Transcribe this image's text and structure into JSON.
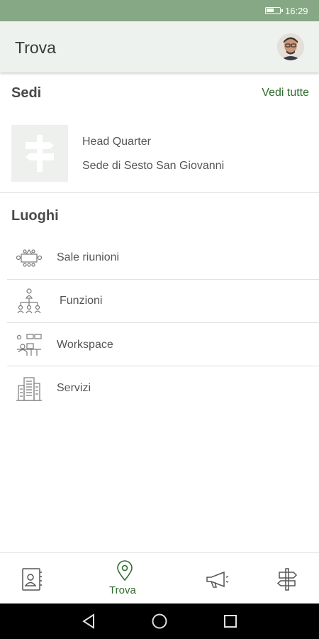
{
  "status_bar": {
    "time": "16:29"
  },
  "app_bar": {
    "title": "Trova"
  },
  "sedi": {
    "title": "Sedi",
    "see_all": "Vedi tutte",
    "item": {
      "name": "Head Quarter",
      "subtitle": "Sede di Sesto San Giovanni"
    }
  },
  "luoghi": {
    "title": "Luoghi",
    "items": [
      {
        "label": "Sale riunioni",
        "icon": "meeting-room-icon"
      },
      {
        "label": "Funzioni",
        "icon": "org-chart-icon"
      },
      {
        "label": "Workspace",
        "icon": "workspace-icon"
      },
      {
        "label": "Servizi",
        "icon": "building-icon"
      }
    ]
  },
  "bottom_nav": {
    "items": [
      {
        "icon": "contacts-book-icon",
        "label": ""
      },
      {
        "icon": "location-pin-icon",
        "label": "Trova",
        "active": true
      },
      {
        "icon": "megaphone-icon",
        "label": ""
      },
      {
        "icon": "signpost-icon",
        "label": ""
      }
    ]
  },
  "colors": {
    "status_bar": "#86a884",
    "app_bar": "#eef2ee",
    "accent": "#2f6b2c",
    "icon_gray": "#7a7a7a"
  }
}
